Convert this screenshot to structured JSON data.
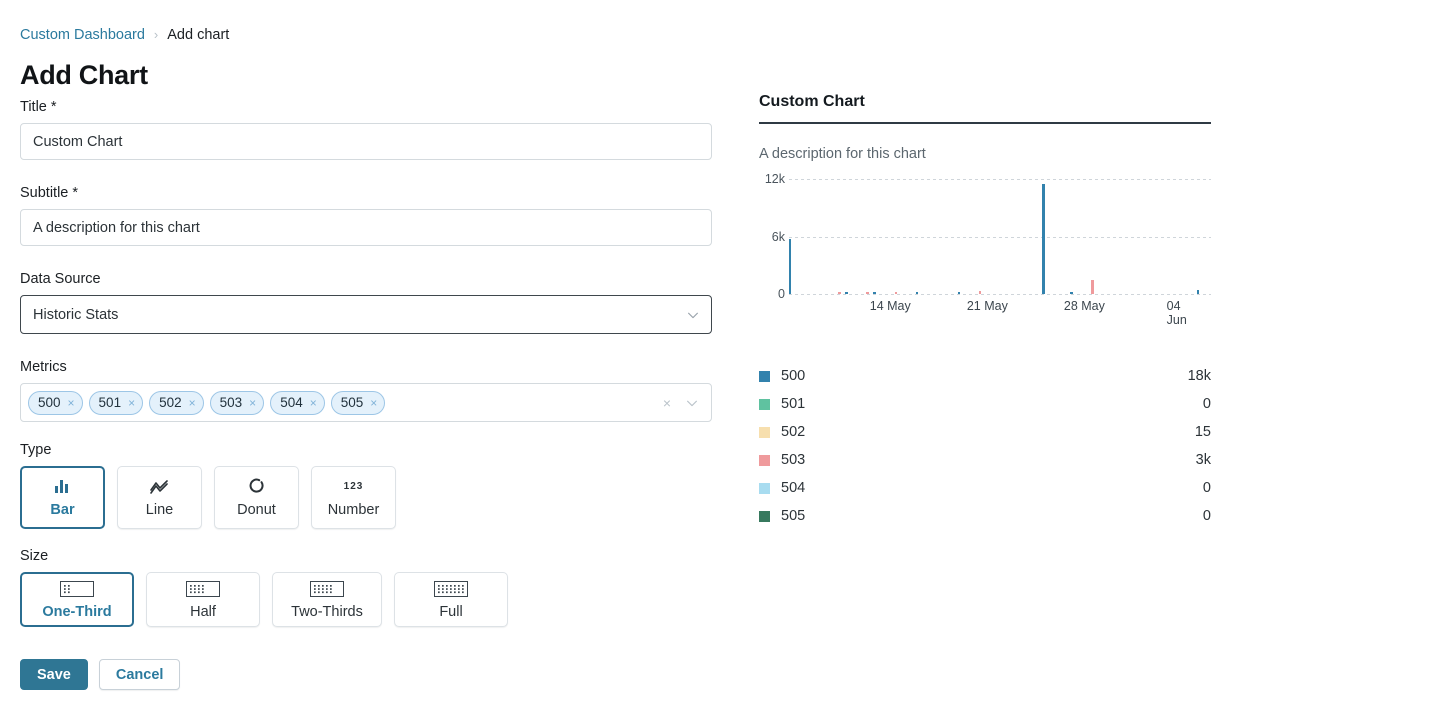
{
  "breadcrumb": {
    "parent": "Custom Dashboard",
    "separator": "›",
    "current": "Add chart"
  },
  "page_title": "Add Chart",
  "form": {
    "title_field": {
      "label": "Title *",
      "value": "Custom Chart",
      "placeholder": "Title"
    },
    "subtitle_field": {
      "label": "Subtitle *",
      "value": "A description for this chart",
      "placeholder": "Subtitle"
    },
    "data_source": {
      "label": "Data Source",
      "value": "Historic Stats",
      "chevron_icon": "chevron-down-icon"
    },
    "metrics": {
      "label": "Metrics",
      "tags": [
        "500",
        "501",
        "502",
        "503",
        "504",
        "505"
      ],
      "remove_glyph": "×",
      "clear_glyph": "×",
      "clear_icon": "clear-icon",
      "chevron_icon": "chevron-down-icon"
    },
    "type": {
      "label": "Type",
      "selected": "Bar",
      "options": [
        {
          "label": "Bar",
          "icon": "bar-chart-icon"
        },
        {
          "label": "Line",
          "icon": "line-chart-icon"
        },
        {
          "label": "Donut",
          "icon": "donut-chart-icon"
        },
        {
          "label": "Number",
          "icon": "number-123-icon"
        }
      ]
    },
    "size": {
      "label": "Size",
      "selected": "One-Third",
      "options": [
        {
          "label": "One-Third",
          "icon": "grid-one-third-icon",
          "cols": 3,
          "width": 114
        },
        {
          "label": "Half",
          "icon": "grid-half-icon",
          "cols": 4,
          "width": 114
        },
        {
          "label": "Two-Thirds",
          "icon": "grid-two-thirds-icon",
          "cols": 5,
          "width": 110
        },
        {
          "label": "Full",
          "icon": "grid-full-icon",
          "cols": 7,
          "width": 114
        }
      ]
    },
    "save_label": "Save",
    "cancel_label": "Cancel"
  },
  "preview": {
    "title": "Custom Chart",
    "subtitle": "A description for this chart"
  },
  "colors": {
    "accent": "#2b7a9e",
    "primary_button": "#2f7694",
    "link": "#2b7a9e",
    "rule": "#2f3a44",
    "tag_bg": "#e4f1fb",
    "tag_border": "#9dc6e6"
  },
  "chart_data": {
    "type": "bar",
    "title": "Custom Chart",
    "subtitle": "A description for this chart",
    "xlabel": "",
    "ylabel": "",
    "ylim": [
      0,
      12000
    ],
    "yticks": [
      0,
      6000,
      12000
    ],
    "ytick_labels": [
      "0",
      "6k",
      "12k"
    ],
    "grid": true,
    "legend_position": "bottom",
    "xtick_labels": [
      "14 May",
      "21 May",
      "28 May",
      "04 Jun"
    ],
    "xtick_positions": [
      0.24,
      0.47,
      0.7,
      0.93
    ],
    "x": [
      "10 May",
      "11 May",
      "12 May",
      "13 May",
      "14 May",
      "15 May",
      "16 May",
      "17 May",
      "18 May",
      "19 May",
      "20 May",
      "21 May",
      "22 May",
      "23 May",
      "24 May",
      "25 May",
      "26 May",
      "27 May",
      "28 May",
      "29 May",
      "30 May",
      "31 May",
      "01 Jun",
      "02 Jun",
      "03 Jun",
      "04 Jun",
      "05 Jun",
      "06 Jun",
      "07 Jun",
      "08 Jun"
    ],
    "series": [
      {
        "name": "500",
        "color": "#3282ad",
        "total": "18k",
        "values": [
          5700,
          0,
          0,
          0,
          60,
          0,
          180,
          0,
          0,
          40,
          0,
          0,
          230,
          0,
          0,
          0,
          0,
          0,
          11500,
          0,
          130,
          0,
          0,
          0,
          0,
          0,
          0,
          0,
          0,
          420
        ]
      },
      {
        "name": "501",
        "color": "#5fc2a0",
        "total": "0",
        "values": [
          0,
          0,
          0,
          0,
          0,
          0,
          0,
          0,
          0,
          0,
          0,
          0,
          0,
          0,
          0,
          0,
          0,
          0,
          0,
          0,
          0,
          0,
          0,
          0,
          0,
          0,
          0,
          0,
          0,
          0
        ]
      },
      {
        "name": "502",
        "color": "#f7dfae",
        "total": "15",
        "values": [
          0,
          0,
          0,
          0,
          0,
          0,
          0,
          0,
          0,
          0,
          0,
          0,
          0,
          0,
          0,
          0,
          0,
          0,
          0,
          0,
          0,
          0,
          0,
          0,
          0,
          0,
          0,
          0,
          0,
          0
        ]
      },
      {
        "name": "503",
        "color": "#ef9a9c",
        "total": "3k",
        "values": [
          0,
          0,
          0,
          60,
          0,
          90,
          0,
          80,
          0,
          0,
          0,
          0,
          0,
          300,
          0,
          0,
          0,
          0,
          0,
          0,
          0,
          1500,
          0,
          0,
          0,
          0,
          0,
          0,
          0,
          0
        ]
      },
      {
        "name": "504",
        "color": "#a8dcf0",
        "total": "0",
        "values": [
          0,
          0,
          0,
          0,
          0,
          0,
          0,
          0,
          0,
          0,
          0,
          0,
          0,
          0,
          0,
          0,
          0,
          0,
          0,
          0,
          0,
          0,
          0,
          0,
          0,
          0,
          0,
          0,
          0,
          0
        ]
      },
      {
        "name": "505",
        "color": "#37795e",
        "total": "0",
        "values": [
          0,
          0,
          0,
          0,
          0,
          0,
          0,
          0,
          0,
          0,
          0,
          0,
          0,
          0,
          0,
          0,
          0,
          0,
          0,
          0,
          0,
          0,
          0,
          0,
          0,
          0,
          0,
          0,
          0,
          0
        ]
      }
    ],
    "legend": [
      {
        "name": "500",
        "value": "18k",
        "color": "#3282ad"
      },
      {
        "name": "501",
        "value": "0",
        "color": "#5fc2a0"
      },
      {
        "name": "502",
        "value": "15",
        "color": "#f7dfae"
      },
      {
        "name": "503",
        "value": "3k",
        "color": "#ef9a9c"
      },
      {
        "name": "504",
        "value": "0",
        "color": "#a8dcf0"
      },
      {
        "name": "505",
        "value": "0",
        "color": "#37795e"
      }
    ]
  }
}
